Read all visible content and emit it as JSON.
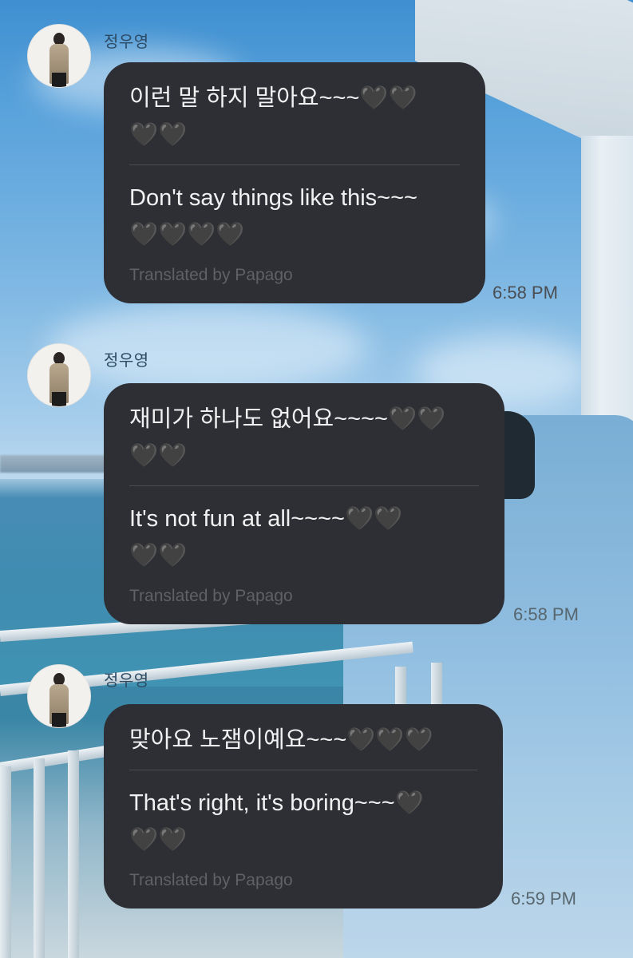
{
  "chat": {
    "messages": [
      {
        "sender": "정우영",
        "original_lines": [
          "이런 말 하지 말아요~~~🖤🖤",
          "🖤🖤"
        ],
        "translated_lines": [
          "Don't say things like this~~~",
          "🖤🖤🖤🖤"
        ],
        "credit": "Translated by Papago",
        "time": "6:58 PM"
      },
      {
        "sender": "정우영",
        "original_lines": [
          "재미가 하나도 없어요~~~~🖤🖤",
          "🖤🖤"
        ],
        "translated_lines": [
          "It's not fun at all~~~~🖤🖤",
          "🖤🖤"
        ],
        "credit": "Translated by Papago",
        "time": "6:58 PM"
      },
      {
        "sender": "정우영",
        "original_lines": [
          "맞아요 노잼이예요~~~🖤🖤🖤"
        ],
        "translated_lines": [
          "That's right, it's boring~~~🖤",
          "🖤🖤"
        ],
        "credit": "Translated by Papago",
        "time": "6:59 PM"
      }
    ]
  },
  "icons": {
    "avatar": "profile-photo-icon"
  },
  "colors": {
    "bubble": "#2e2f34",
    "bubble_text": "#f1f1f3",
    "credit_text": "#5f6167",
    "sender_text": "#2d4a63"
  }
}
